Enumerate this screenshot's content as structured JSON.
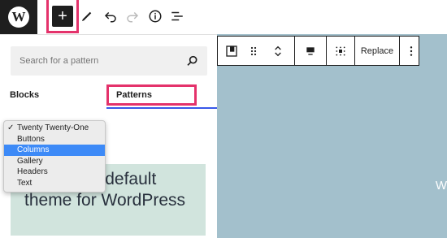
{
  "toolbar": {
    "logo_letter": "W",
    "add_symbol": "+",
    "icons": [
      "wordpress-logo-icon",
      "plus-icon",
      "pencil-icon",
      "undo-icon",
      "redo-icon",
      "info-icon",
      "list-view-icon"
    ]
  },
  "inserter": {
    "search_placeholder": "Search for a pattern",
    "tabs": [
      {
        "label": "Blocks",
        "active": false
      },
      {
        "label": "Patterns",
        "active": true
      }
    ],
    "category_options": [
      {
        "label": "Twenty Twenty-One",
        "checked": true,
        "selected": false
      },
      {
        "label": "Buttons",
        "checked": false,
        "selected": false
      },
      {
        "label": "Columns",
        "checked": false,
        "selected": true
      },
      {
        "label": "Gallery",
        "checked": false,
        "selected": false
      },
      {
        "label": "Headers",
        "checked": false,
        "selected": false
      },
      {
        "label": "Text",
        "checked": false,
        "selected": false
      }
    ],
    "check_mark": "✓",
    "preview_text": "A portfolio default theme for WordPress"
  },
  "block_toolbar": {
    "replace_label": "Replace",
    "icons": [
      "image-block-icon",
      "drag-handle-icon",
      "move-arrows-icon",
      "align-icon",
      "fullwidth-icon",
      "more-options-icon"
    ]
  },
  "canvas": {
    "text_fragment": "W"
  },
  "colors": {
    "highlight": "#e4326b",
    "accent": "#3858e9",
    "dark": "#1e1e1e",
    "preview_bg": "#d1e4dd",
    "canvas_bg": "#a3c0cc",
    "dropdown_selected": "#3d8af7"
  }
}
